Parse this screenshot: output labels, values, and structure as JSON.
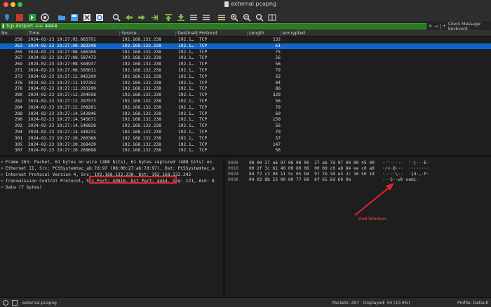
{
  "window": {
    "title": "external.pcapng"
  },
  "filter": {
    "value": "tcp.dstport == 4444",
    "client_message": "Client Message: KeyEvent",
    "plus": "+"
  },
  "columns": [
    "No.",
    "Time",
    "Source",
    "Destinati",
    "Protocol",
    "Length",
    "encrypted"
  ],
  "packets": [
    {
      "no": "258",
      "time": "2024-02-23 19:27:03.665791",
      "src": "192.168.132.238",
      "dst": "192.1…",
      "proto": "TCP",
      "len": "132"
    },
    {
      "no": "263",
      "time": "2024-02-23 19:27:08.383348",
      "src": "192.168.132.238",
      "dst": "192.1…",
      "proto": "TCP",
      "len": "61"
    },
    {
      "no": "265",
      "time": "2024-02-23 19:27:08.586308",
      "src": "192.168.132.238",
      "dst": "192.1…",
      "proto": "TCP",
      "len": "75"
    },
    {
      "no": "267",
      "time": "2024-02-23 19:27:08.587473",
      "src": "192.168.132.238",
      "dst": "192.1…",
      "proto": "TCP",
      "len": "56"
    },
    {
      "no": "269",
      "time": "2024-02-23 19:27:08.594937",
      "src": "192.168.132.238",
      "dst": "192.1…",
      "proto": "TCP",
      "len": "56"
    },
    {
      "no": "271",
      "time": "2024-02-23 19:27:08.595611",
      "src": "192.168.132.238",
      "dst": "192.1…",
      "proto": "TCP",
      "len": "79"
    },
    {
      "no": "273",
      "time": "2024-02-23 19:27:12.042209",
      "src": "192.168.132.238",
      "dst": "192.1…",
      "proto": "TCP",
      "len": "63"
    },
    {
      "no": "276",
      "time": "2024-02-23 19:27:12.197352",
      "src": "192.168.132.238",
      "dst": "192.1…",
      "proto": "TCP",
      "len": "84"
    },
    {
      "no": "278",
      "time": "2024-02-23 19:27:12.203299",
      "src": "192.168.132.238",
      "dst": "192.1…",
      "proto": "TCP",
      "len": "86"
    },
    {
      "no": "280",
      "time": "2024-02-23 19:27:12.204598",
      "src": "192.168.132.238",
      "dst": "192.1…",
      "proto": "TCP",
      "len": "329"
    },
    {
      "no": "282",
      "time": "2024-02-23 19:27:12.207573",
      "src": "192.168.132.238",
      "dst": "192.1…",
      "proto": "TCP",
      "len": "56"
    },
    {
      "no": "284",
      "time": "2024-02-23 19:27:12.208261",
      "src": "192.168.132.238",
      "dst": "192.1…",
      "proto": "TCP",
      "len": "79"
    },
    {
      "no": "288",
      "time": "2024-02-23 19:27:14.542846",
      "src": "192.168.132.238",
      "dst": "192.1…",
      "proto": "TCP",
      "len": "60"
    },
    {
      "no": "290",
      "time": "2024-02-23 19:27:14.545671",
      "src": "192.168.132.238",
      "dst": "192.1…",
      "proto": "TCP",
      "len": "150"
    },
    {
      "no": "292",
      "time": "2024-02-23 19:27:14.546828",
      "src": "192.168.132.238",
      "dst": "192.1…",
      "proto": "TCP",
      "len": "56"
    },
    {
      "no": "294",
      "time": "2024-02-23 19:27:14.548231",
      "src": "192.168.132.238",
      "dst": "192.1…",
      "proto": "TCP",
      "len": "79"
    },
    {
      "no": "301",
      "time": "2024-02-23 19:27:20.266368",
      "src": "192.168.132.238",
      "dst": "192.1…",
      "proto": "TCP",
      "len": "57"
    },
    {
      "no": "305",
      "time": "2024-02-23 19:27:20.268439",
      "src": "192.168.132.238",
      "dst": "192.1…",
      "proto": "TCP",
      "len": "147"
    },
    {
      "no": "307",
      "time": "2024-02-23 19:27:20.269698",
      "src": "192.168.132.238",
      "dst": "192.1…",
      "proto": "TCP",
      "len": "56"
    }
  ],
  "selected_packet": "263",
  "detail": [
    "Frame 263: Packet, 61 bytes on wire (488 bits), 61 bytes captured (488 bits) on",
    "Ethernet II, Src: PCSSystemtec_ab:7d:97 (08:00:27:ab:7d:97), Dst: PCSSystemtec_a",
    "Internet Protocol Version 4, Src: 192.168.132.238, Dst: 192.168.132.242",
    "Transmission Control Protocol, Src Port: 49816, Dst Port: 4444, Seq: 121, Ack: 8",
    "Data (7 bytes)"
  ],
  "hex": [
    {
      "off": "0000",
      "bytes": "08 00 27 a6 97 06 08 00  27 ab 7d 97 08 00 45 00",
      "ascii": "··'·····  '·}···E·"
    },
    {
      "off": "0010",
      "bytes": "00 2f 3c b1 40 00 80 06  00 00 c0 a8 84 ee c0 a8",
      "ascii": "·/<·@···  ········"
    },
    {
      "off": "0020",
      "bytes": "84 f2 c2 98 11 5c 05 b8  97 7b 34 e3 2c 16 50 18",
      "ascii": "·····\\··  ·{4·,·P·"
    },
    {
      "off": "0030",
      "bytes": "04 02 8b 53 00 00 77 68  6f 61 6d 69 0a",
      "ascii": "···S··wh oami·"
    }
  ],
  "annotation": "shell Windows",
  "status": {
    "file": "external.pcapng",
    "packets": "Packets: 457 · Displayed: 50 (10.9%)",
    "profile": "Profile: Default"
  }
}
